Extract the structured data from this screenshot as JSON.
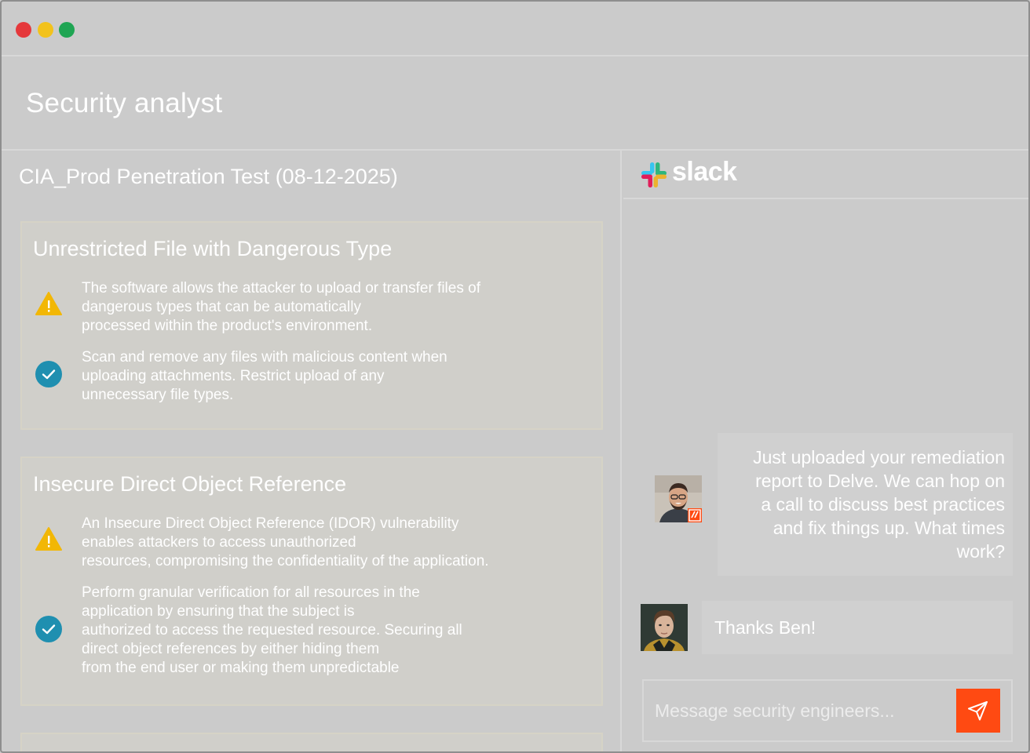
{
  "window": {
    "controls": [
      "close",
      "minimize",
      "maximize"
    ],
    "colors": {
      "close": "#e5383b",
      "minimize": "#f2c21c",
      "maximize": "#1fa553"
    }
  },
  "page": {
    "title": "Security analyst"
  },
  "report": {
    "title": "CIA_Prod Penetration Test (08-12-2025)",
    "findings": [
      {
        "title": "Unrestricted File with Dangerous Type",
        "issue_lines": [
          "The software allows the attacker to upload or transfer files of",
          "dangerous types that can be automatically",
          "processed within the product's environment."
        ],
        "fix_lines": [
          "Scan and remove any files with malicious content when",
          "uploading attachments. Restrict upload of any",
          "unnecessary file types."
        ]
      },
      {
        "title": "Insecure Direct Object Reference",
        "issue_lines": [
          "An Insecure Direct Object Reference (IDOR) vulnerability",
          "enables attackers to access unauthorized",
          "resources, compromising the confidentiality of the application."
        ],
        "fix_lines": [
          "Perform granular verification for all resources in the",
          "application by ensuring that the subject is",
          "authorized to access the requested resource. Securing all",
          "direct object references by either hiding them",
          "from the end user or making them unpredictable"
        ]
      }
    ],
    "icons": {
      "issue": "warning-icon",
      "fix": "check-circle-icon"
    },
    "colors": {
      "warning": "#f2b705",
      "check": "#1f8fb0"
    }
  },
  "chat": {
    "app_name": "slack",
    "messages": [
      {
        "lines": [
          "Just uploaded your remediation",
          "report to Delve. We can hop on",
          "a call to discuss best practices",
          "and fix things up. What times",
          "work?"
        ]
      },
      {
        "text": "Thanks Ben!"
      }
    ],
    "composer": {
      "placeholder": "Message security engineers..."
    },
    "colors": {
      "send": "#ff4a12"
    }
  }
}
